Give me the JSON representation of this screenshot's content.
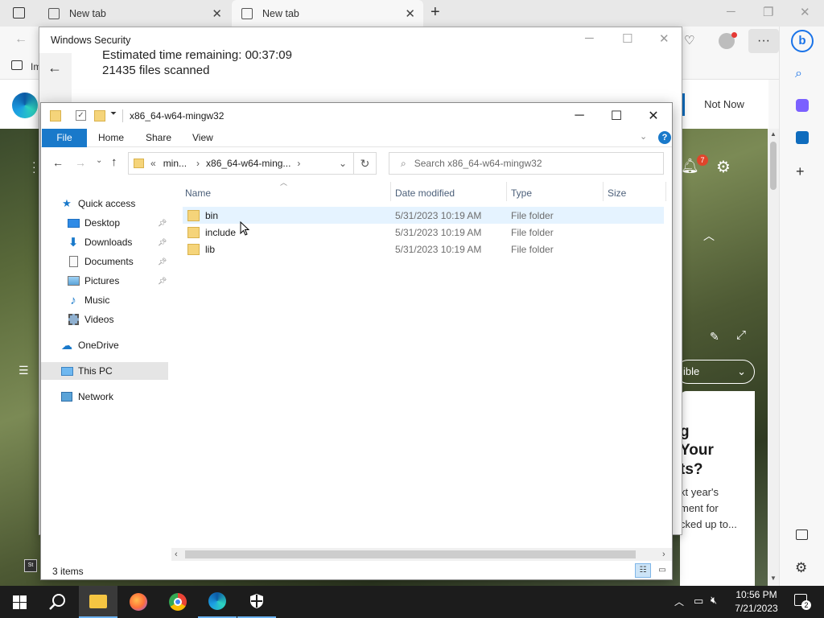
{
  "browser": {
    "tabs": [
      {
        "label": "New tab"
      },
      {
        "label": "New tab"
      }
    ],
    "favorites_label": "Im",
    "header": {
      "not_now": "Not Now"
    },
    "notification_count": "7",
    "pill_label": "ible",
    "card": {
      "lines": [
        "g",
        "Your",
        "ts?"
      ],
      "sub": [
        "xt year's",
        "ment for",
        "cked up to..."
      ]
    }
  },
  "security": {
    "title": "Windows Security",
    "time_remaining": "Estimated time remaining: 00:37:09",
    "files_scanned": "21435  files scanned"
  },
  "explorer": {
    "title": "x86_64-w64-mingw32",
    "ribbon": {
      "file": "File",
      "home": "Home",
      "share": "Share",
      "view": "View"
    },
    "address": {
      "crumb1": "min...",
      "crumb2": "x86_64-w64-ming..."
    },
    "search_placeholder": "Search x86_64-w64-mingw32",
    "nav": {
      "quick_access": "Quick access",
      "desktop": "Desktop",
      "downloads": "Downloads",
      "documents": "Documents",
      "pictures": "Pictures",
      "music": "Music",
      "videos": "Videos",
      "onedrive": "OneDrive",
      "this_pc": "This PC",
      "network": "Network"
    },
    "columns": {
      "name": "Name",
      "date": "Date modified",
      "type": "Type",
      "size": "Size"
    },
    "rows": [
      {
        "name": "bin",
        "date": "5/31/2023 10:19 AM",
        "type": "File folder"
      },
      {
        "name": "include",
        "date": "5/31/2023 10:19 AM",
        "type": "File folder"
      },
      {
        "name": "lib",
        "date": "5/31/2023 10:19 AM",
        "type": "File folder"
      }
    ],
    "status": "3 items"
  },
  "taskbar": {
    "time": "10:56 PM",
    "date": "7/21/2023",
    "notification_count": "2"
  }
}
